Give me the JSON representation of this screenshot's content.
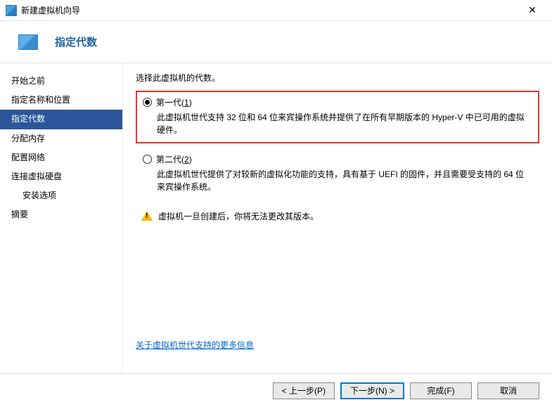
{
  "titlebar": {
    "title": "新建虚拟机向导"
  },
  "header": {
    "title": "指定代数"
  },
  "sidebar": {
    "items": [
      {
        "label": "开始之前",
        "active": false,
        "indent": false
      },
      {
        "label": "指定名称和位置",
        "active": false,
        "indent": false
      },
      {
        "label": "指定代数",
        "active": true,
        "indent": false
      },
      {
        "label": "分配内存",
        "active": false,
        "indent": false
      },
      {
        "label": "配置网络",
        "active": false,
        "indent": false
      },
      {
        "label": "连接虚拟硬盘",
        "active": false,
        "indent": false
      },
      {
        "label": "安装选项",
        "active": false,
        "indent": true
      },
      {
        "label": "摘要",
        "active": false,
        "indent": false
      }
    ]
  },
  "main": {
    "instruction": "选择此虚拟机的代数。",
    "option1": {
      "label_prefix": "第一代(",
      "hotkey": "1",
      "label_suffix": ")",
      "desc": "此虚拟机世代支持 32 位和 64 位来宾操作系统并提供了在所有早期版本的 Hyper-V 中已可用的虚拟硬件。"
    },
    "option2": {
      "label_prefix": "第二代(",
      "hotkey": "2",
      "label_suffix": ")",
      "desc": "此虚拟机世代提供了对较新的虚拟化功能的支持，具有基于 UEFI 的固件，并且需要受支持的 64 位来宾操作系统。"
    },
    "warning": "虚拟机一旦创建后，你将无法更改其版本。",
    "link": "关于虚拟机世代支持的更多信息"
  },
  "footer": {
    "prev": "< 上一步(P)",
    "next": "下一步(N) >",
    "finish": "完成(F)",
    "cancel": "取消"
  }
}
